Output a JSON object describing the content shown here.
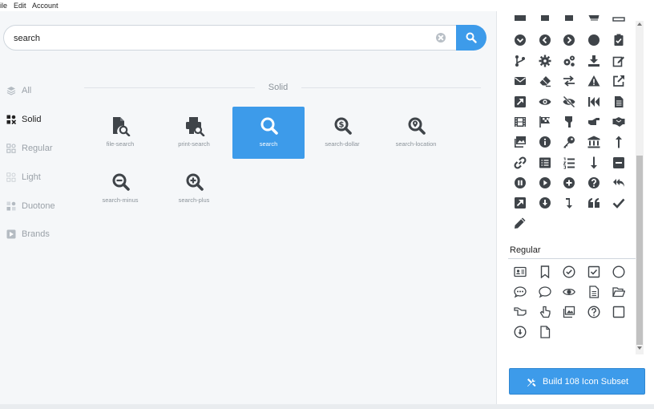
{
  "menu": {
    "file": "ile",
    "edit": "Edit",
    "account": "Account"
  },
  "search": {
    "value": "search",
    "placeholder": ""
  },
  "sidebar": {
    "items": [
      {
        "label": "All"
      },
      {
        "label": "Solid"
      },
      {
        "label": "Regular"
      },
      {
        "label": "Light"
      },
      {
        "label": "Duotone"
      },
      {
        "label": "Brands"
      }
    ]
  },
  "section": {
    "title": "Solid"
  },
  "results": [
    {
      "label": "file-search",
      "icon": "file-search-icon"
    },
    {
      "label": "print-search",
      "icon": "print-search-icon"
    },
    {
      "label": "search",
      "icon": "search-icon"
    },
    {
      "label": "search-dollar",
      "icon": "search-dollar-icon"
    },
    {
      "label": "search-location",
      "icon": "search-location-icon"
    },
    {
      "label": "search-minus",
      "icon": "search-minus-icon"
    },
    {
      "label": "search-plus",
      "icon": "search-plus-icon"
    }
  ],
  "subset": {
    "regular_title": "Regular",
    "build_label": "Build 108 Icon Subset"
  },
  "colors": {
    "accent": "#3d9bea",
    "icon": "#3f4449",
    "muted": "#9aa1a8"
  }
}
